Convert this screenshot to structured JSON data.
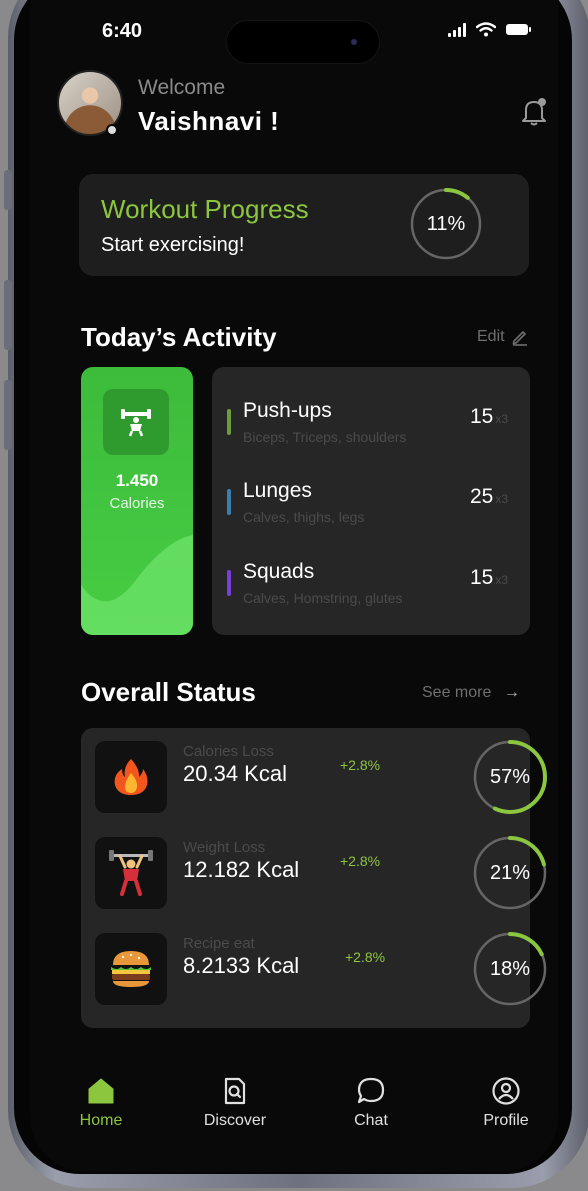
{
  "colors": {
    "accent": "#8cc63f",
    "card": "#262626",
    "bar_pushups": "#6a9d3c",
    "bar_lunges": "#3b7fb0",
    "bar_squads": "#7a3fd8"
  },
  "status_bar": {
    "time": "6:40"
  },
  "header": {
    "greeting": "Welcome",
    "username": "Vaishnavi !"
  },
  "workout_progress": {
    "title": "Workout Progress",
    "subtitle": "Start exercising!",
    "percent_label": "11%",
    "percent": 11
  },
  "today_activity": {
    "title": "Today’s Activity",
    "edit_label": "Edit",
    "calories": {
      "value": "1.450",
      "label": "Calories"
    },
    "exercises": [
      {
        "name": "Push-ups",
        "muscles": "Biceps, Triceps, shoulders",
        "reps": "15",
        "sets": "x3",
        "color": "#6a9d3c"
      },
      {
        "name": "Lunges",
        "muscles": "Calves, thighs, legs",
        "reps": "25",
        "sets": "x3",
        "color": "#3b7fb0"
      },
      {
        "name": "Squads",
        "muscles": "Calves, Homstring, glutes",
        "reps": "15",
        "sets": "x3",
        "color": "#7a3fd8"
      }
    ]
  },
  "overall_status": {
    "title": "Overall Status",
    "see_more_label": "See more",
    "items": [
      {
        "icon": "fire-icon",
        "label": "Calories Loss",
        "value": "20.34 Kcal",
        "change": "+2.8%",
        "percent_label": "57%",
        "percent": 57
      },
      {
        "icon": "weightlifter-icon",
        "label": "Weight Loss",
        "value": "12.182 Kcal",
        "change": "+2.8%",
        "percent_label": "21%",
        "percent": 21
      },
      {
        "icon": "burger-icon",
        "label": "Recipe eat",
        "value": "8.2133 Kcal",
        "change": "+2.8%",
        "percent_label": "18%",
        "percent": 18
      }
    ]
  },
  "nav": {
    "items": [
      {
        "label": "Home",
        "icon": "home-icon",
        "active": true
      },
      {
        "label": "Discover",
        "icon": "discover-icon",
        "active": false
      },
      {
        "label": "Chat",
        "icon": "chat-icon",
        "active": false
      },
      {
        "label": "Profile",
        "icon": "profile-icon",
        "active": false
      }
    ]
  }
}
